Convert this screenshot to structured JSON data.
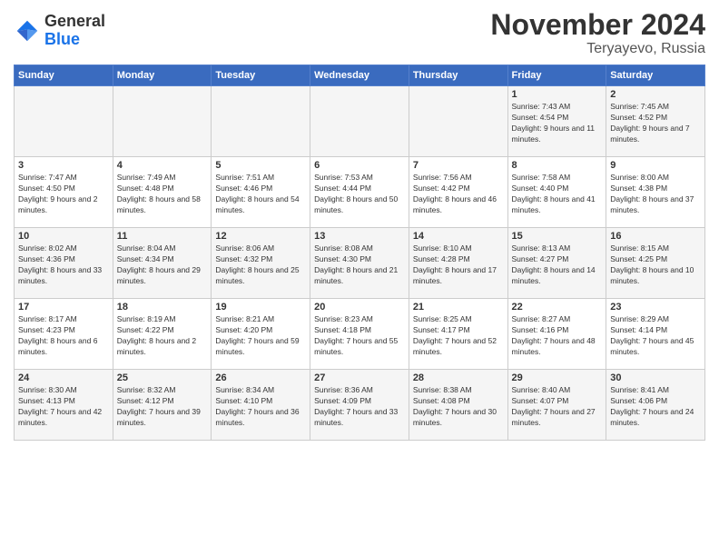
{
  "header": {
    "logo_line1": "General",
    "logo_line2": "Blue",
    "month": "November 2024",
    "location": "Teryayevo, Russia"
  },
  "days_of_week": [
    "Sunday",
    "Monday",
    "Tuesday",
    "Wednesday",
    "Thursday",
    "Friday",
    "Saturday"
  ],
  "weeks": [
    [
      {
        "day": "",
        "sunrise": "",
        "sunset": "",
        "daylight": ""
      },
      {
        "day": "",
        "sunrise": "",
        "sunset": "",
        "daylight": ""
      },
      {
        "day": "",
        "sunrise": "",
        "sunset": "",
        "daylight": ""
      },
      {
        "day": "",
        "sunrise": "",
        "sunset": "",
        "daylight": ""
      },
      {
        "day": "",
        "sunrise": "",
        "sunset": "",
        "daylight": ""
      },
      {
        "day": "1",
        "sunrise": "Sunrise: 7:43 AM",
        "sunset": "Sunset: 4:54 PM",
        "daylight": "Daylight: 9 hours and 11 minutes."
      },
      {
        "day": "2",
        "sunrise": "Sunrise: 7:45 AM",
        "sunset": "Sunset: 4:52 PM",
        "daylight": "Daylight: 9 hours and 7 minutes."
      }
    ],
    [
      {
        "day": "3",
        "sunrise": "Sunrise: 7:47 AM",
        "sunset": "Sunset: 4:50 PM",
        "daylight": "Daylight: 9 hours and 2 minutes."
      },
      {
        "day": "4",
        "sunrise": "Sunrise: 7:49 AM",
        "sunset": "Sunset: 4:48 PM",
        "daylight": "Daylight: 8 hours and 58 minutes."
      },
      {
        "day": "5",
        "sunrise": "Sunrise: 7:51 AM",
        "sunset": "Sunset: 4:46 PM",
        "daylight": "Daylight: 8 hours and 54 minutes."
      },
      {
        "day": "6",
        "sunrise": "Sunrise: 7:53 AM",
        "sunset": "Sunset: 4:44 PM",
        "daylight": "Daylight: 8 hours and 50 minutes."
      },
      {
        "day": "7",
        "sunrise": "Sunrise: 7:56 AM",
        "sunset": "Sunset: 4:42 PM",
        "daylight": "Daylight: 8 hours and 46 minutes."
      },
      {
        "day": "8",
        "sunrise": "Sunrise: 7:58 AM",
        "sunset": "Sunset: 4:40 PM",
        "daylight": "Daylight: 8 hours and 41 minutes."
      },
      {
        "day": "9",
        "sunrise": "Sunrise: 8:00 AM",
        "sunset": "Sunset: 4:38 PM",
        "daylight": "Daylight: 8 hours and 37 minutes."
      }
    ],
    [
      {
        "day": "10",
        "sunrise": "Sunrise: 8:02 AM",
        "sunset": "Sunset: 4:36 PM",
        "daylight": "Daylight: 8 hours and 33 minutes."
      },
      {
        "day": "11",
        "sunrise": "Sunrise: 8:04 AM",
        "sunset": "Sunset: 4:34 PM",
        "daylight": "Daylight: 8 hours and 29 minutes."
      },
      {
        "day": "12",
        "sunrise": "Sunrise: 8:06 AM",
        "sunset": "Sunset: 4:32 PM",
        "daylight": "Daylight: 8 hours and 25 minutes."
      },
      {
        "day": "13",
        "sunrise": "Sunrise: 8:08 AM",
        "sunset": "Sunset: 4:30 PM",
        "daylight": "Daylight: 8 hours and 21 minutes."
      },
      {
        "day": "14",
        "sunrise": "Sunrise: 8:10 AM",
        "sunset": "Sunset: 4:28 PM",
        "daylight": "Daylight: 8 hours and 17 minutes."
      },
      {
        "day": "15",
        "sunrise": "Sunrise: 8:13 AM",
        "sunset": "Sunset: 4:27 PM",
        "daylight": "Daylight: 8 hours and 14 minutes."
      },
      {
        "day": "16",
        "sunrise": "Sunrise: 8:15 AM",
        "sunset": "Sunset: 4:25 PM",
        "daylight": "Daylight: 8 hours and 10 minutes."
      }
    ],
    [
      {
        "day": "17",
        "sunrise": "Sunrise: 8:17 AM",
        "sunset": "Sunset: 4:23 PM",
        "daylight": "Daylight: 8 hours and 6 minutes."
      },
      {
        "day": "18",
        "sunrise": "Sunrise: 8:19 AM",
        "sunset": "Sunset: 4:22 PM",
        "daylight": "Daylight: 8 hours and 2 minutes."
      },
      {
        "day": "19",
        "sunrise": "Sunrise: 8:21 AM",
        "sunset": "Sunset: 4:20 PM",
        "daylight": "Daylight: 7 hours and 59 minutes."
      },
      {
        "day": "20",
        "sunrise": "Sunrise: 8:23 AM",
        "sunset": "Sunset: 4:18 PM",
        "daylight": "Daylight: 7 hours and 55 minutes."
      },
      {
        "day": "21",
        "sunrise": "Sunrise: 8:25 AM",
        "sunset": "Sunset: 4:17 PM",
        "daylight": "Daylight: 7 hours and 52 minutes."
      },
      {
        "day": "22",
        "sunrise": "Sunrise: 8:27 AM",
        "sunset": "Sunset: 4:16 PM",
        "daylight": "Daylight: 7 hours and 48 minutes."
      },
      {
        "day": "23",
        "sunrise": "Sunrise: 8:29 AM",
        "sunset": "Sunset: 4:14 PM",
        "daylight": "Daylight: 7 hours and 45 minutes."
      }
    ],
    [
      {
        "day": "24",
        "sunrise": "Sunrise: 8:30 AM",
        "sunset": "Sunset: 4:13 PM",
        "daylight": "Daylight: 7 hours and 42 minutes."
      },
      {
        "day": "25",
        "sunrise": "Sunrise: 8:32 AM",
        "sunset": "Sunset: 4:12 PM",
        "daylight": "Daylight: 7 hours and 39 minutes."
      },
      {
        "day": "26",
        "sunrise": "Sunrise: 8:34 AM",
        "sunset": "Sunset: 4:10 PM",
        "daylight": "Daylight: 7 hours and 36 minutes."
      },
      {
        "day": "27",
        "sunrise": "Sunrise: 8:36 AM",
        "sunset": "Sunset: 4:09 PM",
        "daylight": "Daylight: 7 hours and 33 minutes."
      },
      {
        "day": "28",
        "sunrise": "Sunrise: 8:38 AM",
        "sunset": "Sunset: 4:08 PM",
        "daylight": "Daylight: 7 hours and 30 minutes."
      },
      {
        "day": "29",
        "sunrise": "Sunrise: 8:40 AM",
        "sunset": "Sunset: 4:07 PM",
        "daylight": "Daylight: 7 hours and 27 minutes."
      },
      {
        "day": "30",
        "sunrise": "Sunrise: 8:41 AM",
        "sunset": "Sunset: 4:06 PM",
        "daylight": "Daylight: 7 hours and 24 minutes."
      }
    ]
  ]
}
